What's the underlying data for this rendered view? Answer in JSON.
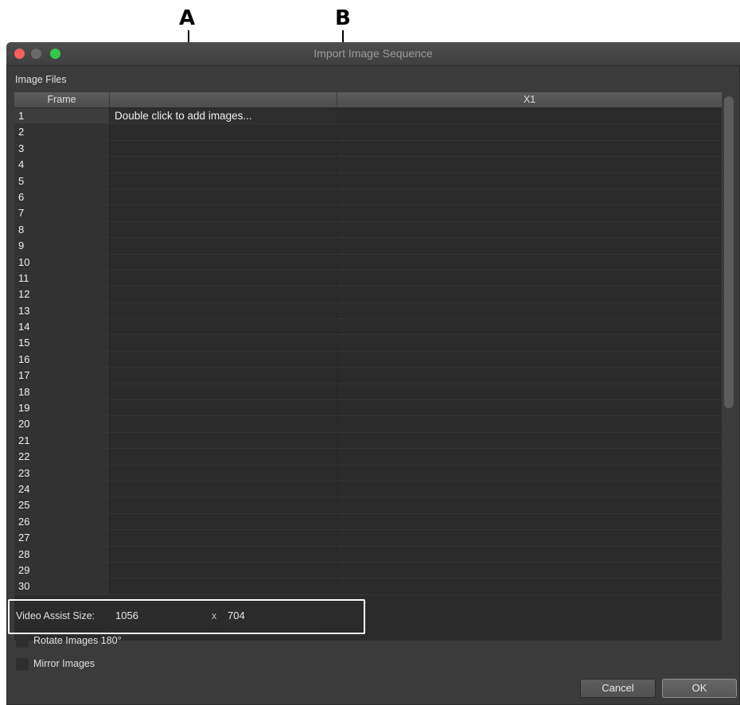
{
  "annotations": {
    "a": "A",
    "b": "B"
  },
  "window": {
    "title": "Import Image Sequence"
  },
  "section": {
    "label": "Image Files"
  },
  "table": {
    "headers": {
      "frame": "Frame",
      "x1": "X1"
    },
    "placeholder": "Double click to add images...",
    "rows": [
      "1",
      "2",
      "3",
      "4",
      "5",
      "6",
      "7",
      "8",
      "9",
      "10",
      "11",
      "12",
      "13",
      "14",
      "15",
      "16",
      "17",
      "18",
      "19",
      "20",
      "21",
      "22",
      "23",
      "24",
      "25",
      "26",
      "27",
      "28",
      "29",
      "30"
    ]
  },
  "video_assist": {
    "label": "Video Assist Size:",
    "width": "1056",
    "separator": "x",
    "height": "704"
  },
  "options": {
    "rotate": "Rotate Images 180°",
    "mirror": "Mirror Images"
  },
  "buttons": {
    "cancel": "Cancel",
    "ok": "OK"
  },
  "colors": {
    "close": "#fc605c",
    "maximize": "#34c84a",
    "window_bg": "#3b3b3b"
  }
}
